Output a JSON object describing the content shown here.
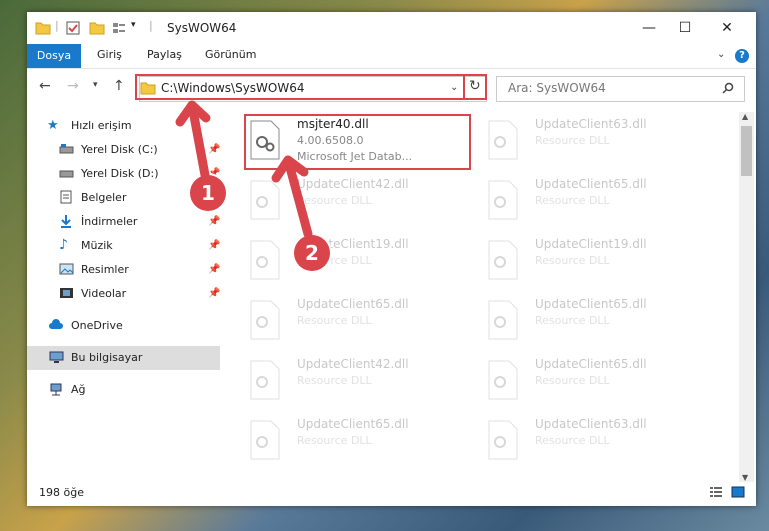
{
  "window": {
    "title": "SysWOW64"
  },
  "ribbon": {
    "tabs": [
      "Dosya",
      "Giriş",
      "Paylaş",
      "Görünüm"
    ]
  },
  "address": {
    "path": "C:\\Windows\\SysWOW64"
  },
  "search": {
    "placeholder": "Ara: SysWOW64"
  },
  "sidebar": {
    "items": [
      {
        "label": "Hızlı erişim"
      },
      {
        "label": "Yerel Disk (C:)"
      },
      {
        "label": "Yerel Disk (D:)"
      },
      {
        "label": "Belgeler"
      },
      {
        "label": "İndirmeler"
      },
      {
        "label": "Müzik"
      },
      {
        "label": "Resimler"
      },
      {
        "label": "Videolar"
      },
      {
        "label": "OneDrive"
      },
      {
        "label": "Bu bilgisayar"
      },
      {
        "label": "Ağ"
      }
    ]
  },
  "files": [
    {
      "name": "msjter40.dll",
      "line1": "4.00.6508.0",
      "line2": "Microsoft Jet Datab..."
    },
    {
      "name": "UpdateClient63.dll",
      "line1": "Resource DLL"
    },
    {
      "name": "UpdateClient42.dll",
      "line1": "Resource DLL"
    },
    {
      "name": "UpdateClient65.dll",
      "line1": "Resource DLL"
    },
    {
      "name": "UpdateClient19.dll",
      "line1": "Resource DLL"
    },
    {
      "name": "UpdateClient19.dll",
      "line1": "Resource DLL"
    },
    {
      "name": "UpdateClient65.dll",
      "line1": "Resource DLL"
    },
    {
      "name": "UpdateClient65.dll",
      "line1": "Resource DLL"
    },
    {
      "name": "UpdateClient42.dll",
      "line1": "Resource DLL"
    },
    {
      "name": "UpdateClient65.dll",
      "line1": "Resource DLL"
    },
    {
      "name": "UpdateClient65.dll",
      "line1": "Resource DLL"
    },
    {
      "name": "UpdateClient63.dll",
      "line1": "Resource DLL"
    }
  ],
  "status": {
    "count": "198 öğe"
  },
  "annotations": [
    "1",
    "2"
  ],
  "colors": {
    "accent": "#1979ca",
    "highlight": "#d9454a"
  }
}
